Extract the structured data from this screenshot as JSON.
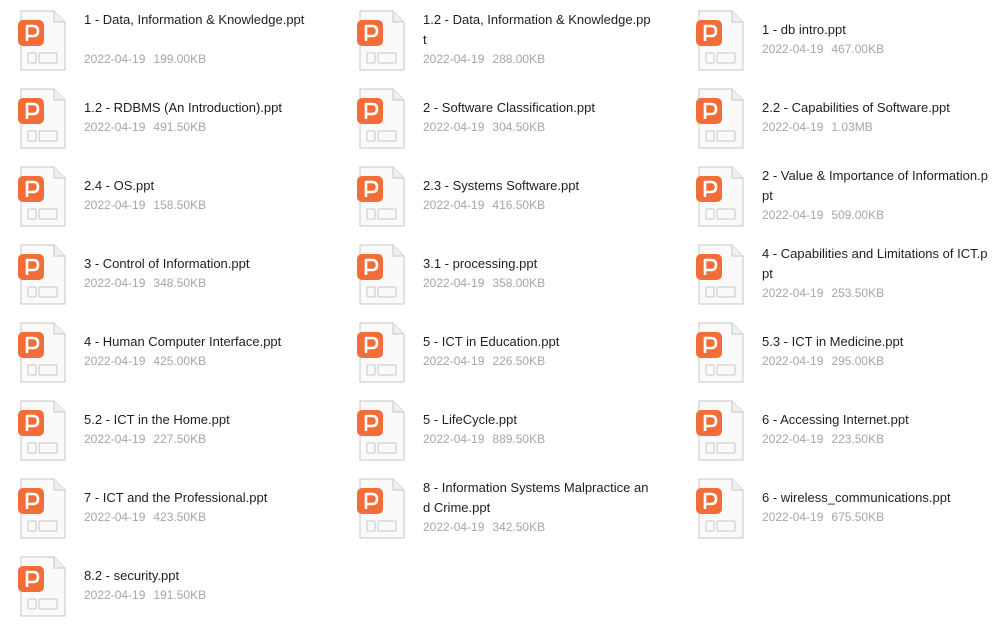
{
  "colors": {
    "icon_accent": "#f26d38",
    "name_text": "#1f1f1f",
    "meta_text": "#a6a6a6"
  },
  "file_icon": "powerpoint-file-icon",
  "files": [
    {
      "name": "1 - Data, Information & Knowledge.ppt",
      "date": "2022-04-19",
      "size": "199.00KB"
    },
    {
      "name": "1.2 - Data, Information & Knowledge.ppt",
      "date": "2022-04-19",
      "size": "288.00KB"
    },
    {
      "name": "1 - db intro.ppt",
      "date": "2022-04-19",
      "size": "467.00KB"
    },
    {
      "name": "1.2 - RDBMS (An Introduction).ppt",
      "date": "2022-04-19",
      "size": "491.50KB"
    },
    {
      "name": "2 - Software Classification.ppt",
      "date": "2022-04-19",
      "size": "304.50KB"
    },
    {
      "name": "2.2 - Capabilities of Software.ppt",
      "date": "2022-04-19",
      "size": "1.03MB"
    },
    {
      "name": "2.4 - OS.ppt",
      "date": "2022-04-19",
      "size": "158.50KB"
    },
    {
      "name": "2.3 - Systems Software.ppt",
      "date": "2022-04-19",
      "size": "416.50KB"
    },
    {
      "name": "2 - Value & Importance of Information.ppt",
      "date": "2022-04-19",
      "size": "509.00KB"
    },
    {
      "name": "3 - Control of Information.ppt",
      "date": "2022-04-19",
      "size": "348.50KB"
    },
    {
      "name": "3.1 - processing.ppt",
      "date": "2022-04-19",
      "size": "358.00KB"
    },
    {
      "name": "4 - Capabilities and Limitations of ICT.ppt",
      "date": "2022-04-19",
      "size": "253.50KB"
    },
    {
      "name": "4 - Human Computer Interface.ppt",
      "date": "2022-04-19",
      "size": "425.00KB"
    },
    {
      "name": "5 - ICT in Education.ppt",
      "date": "2022-04-19",
      "size": "226.50KB"
    },
    {
      "name": "5.3 - ICT in Medicine.ppt",
      "date": "2022-04-19",
      "size": "295.00KB"
    },
    {
      "name": "5.2 - ICT in the Home.ppt",
      "date": "2022-04-19",
      "size": "227.50KB"
    },
    {
      "name": "5 - LifeCycle.ppt",
      "date": "2022-04-19",
      "size": "889.50KB"
    },
    {
      "name": "6 - Accessing Internet.ppt",
      "date": "2022-04-19",
      "size": "223.50KB"
    },
    {
      "name": "7 - ICT and the Professional.ppt",
      "date": "2022-04-19",
      "size": "423.50KB"
    },
    {
      "name": "8 - Information Systems Malpractice and Crime.ppt",
      "date": "2022-04-19",
      "size": "342.50KB"
    },
    {
      "name": "6 - wireless_communications.ppt",
      "date": "2022-04-19",
      "size": "675.50KB"
    },
    {
      "name": "8.2 - security.ppt",
      "date": "2022-04-19",
      "size": "191.50KB"
    }
  ]
}
